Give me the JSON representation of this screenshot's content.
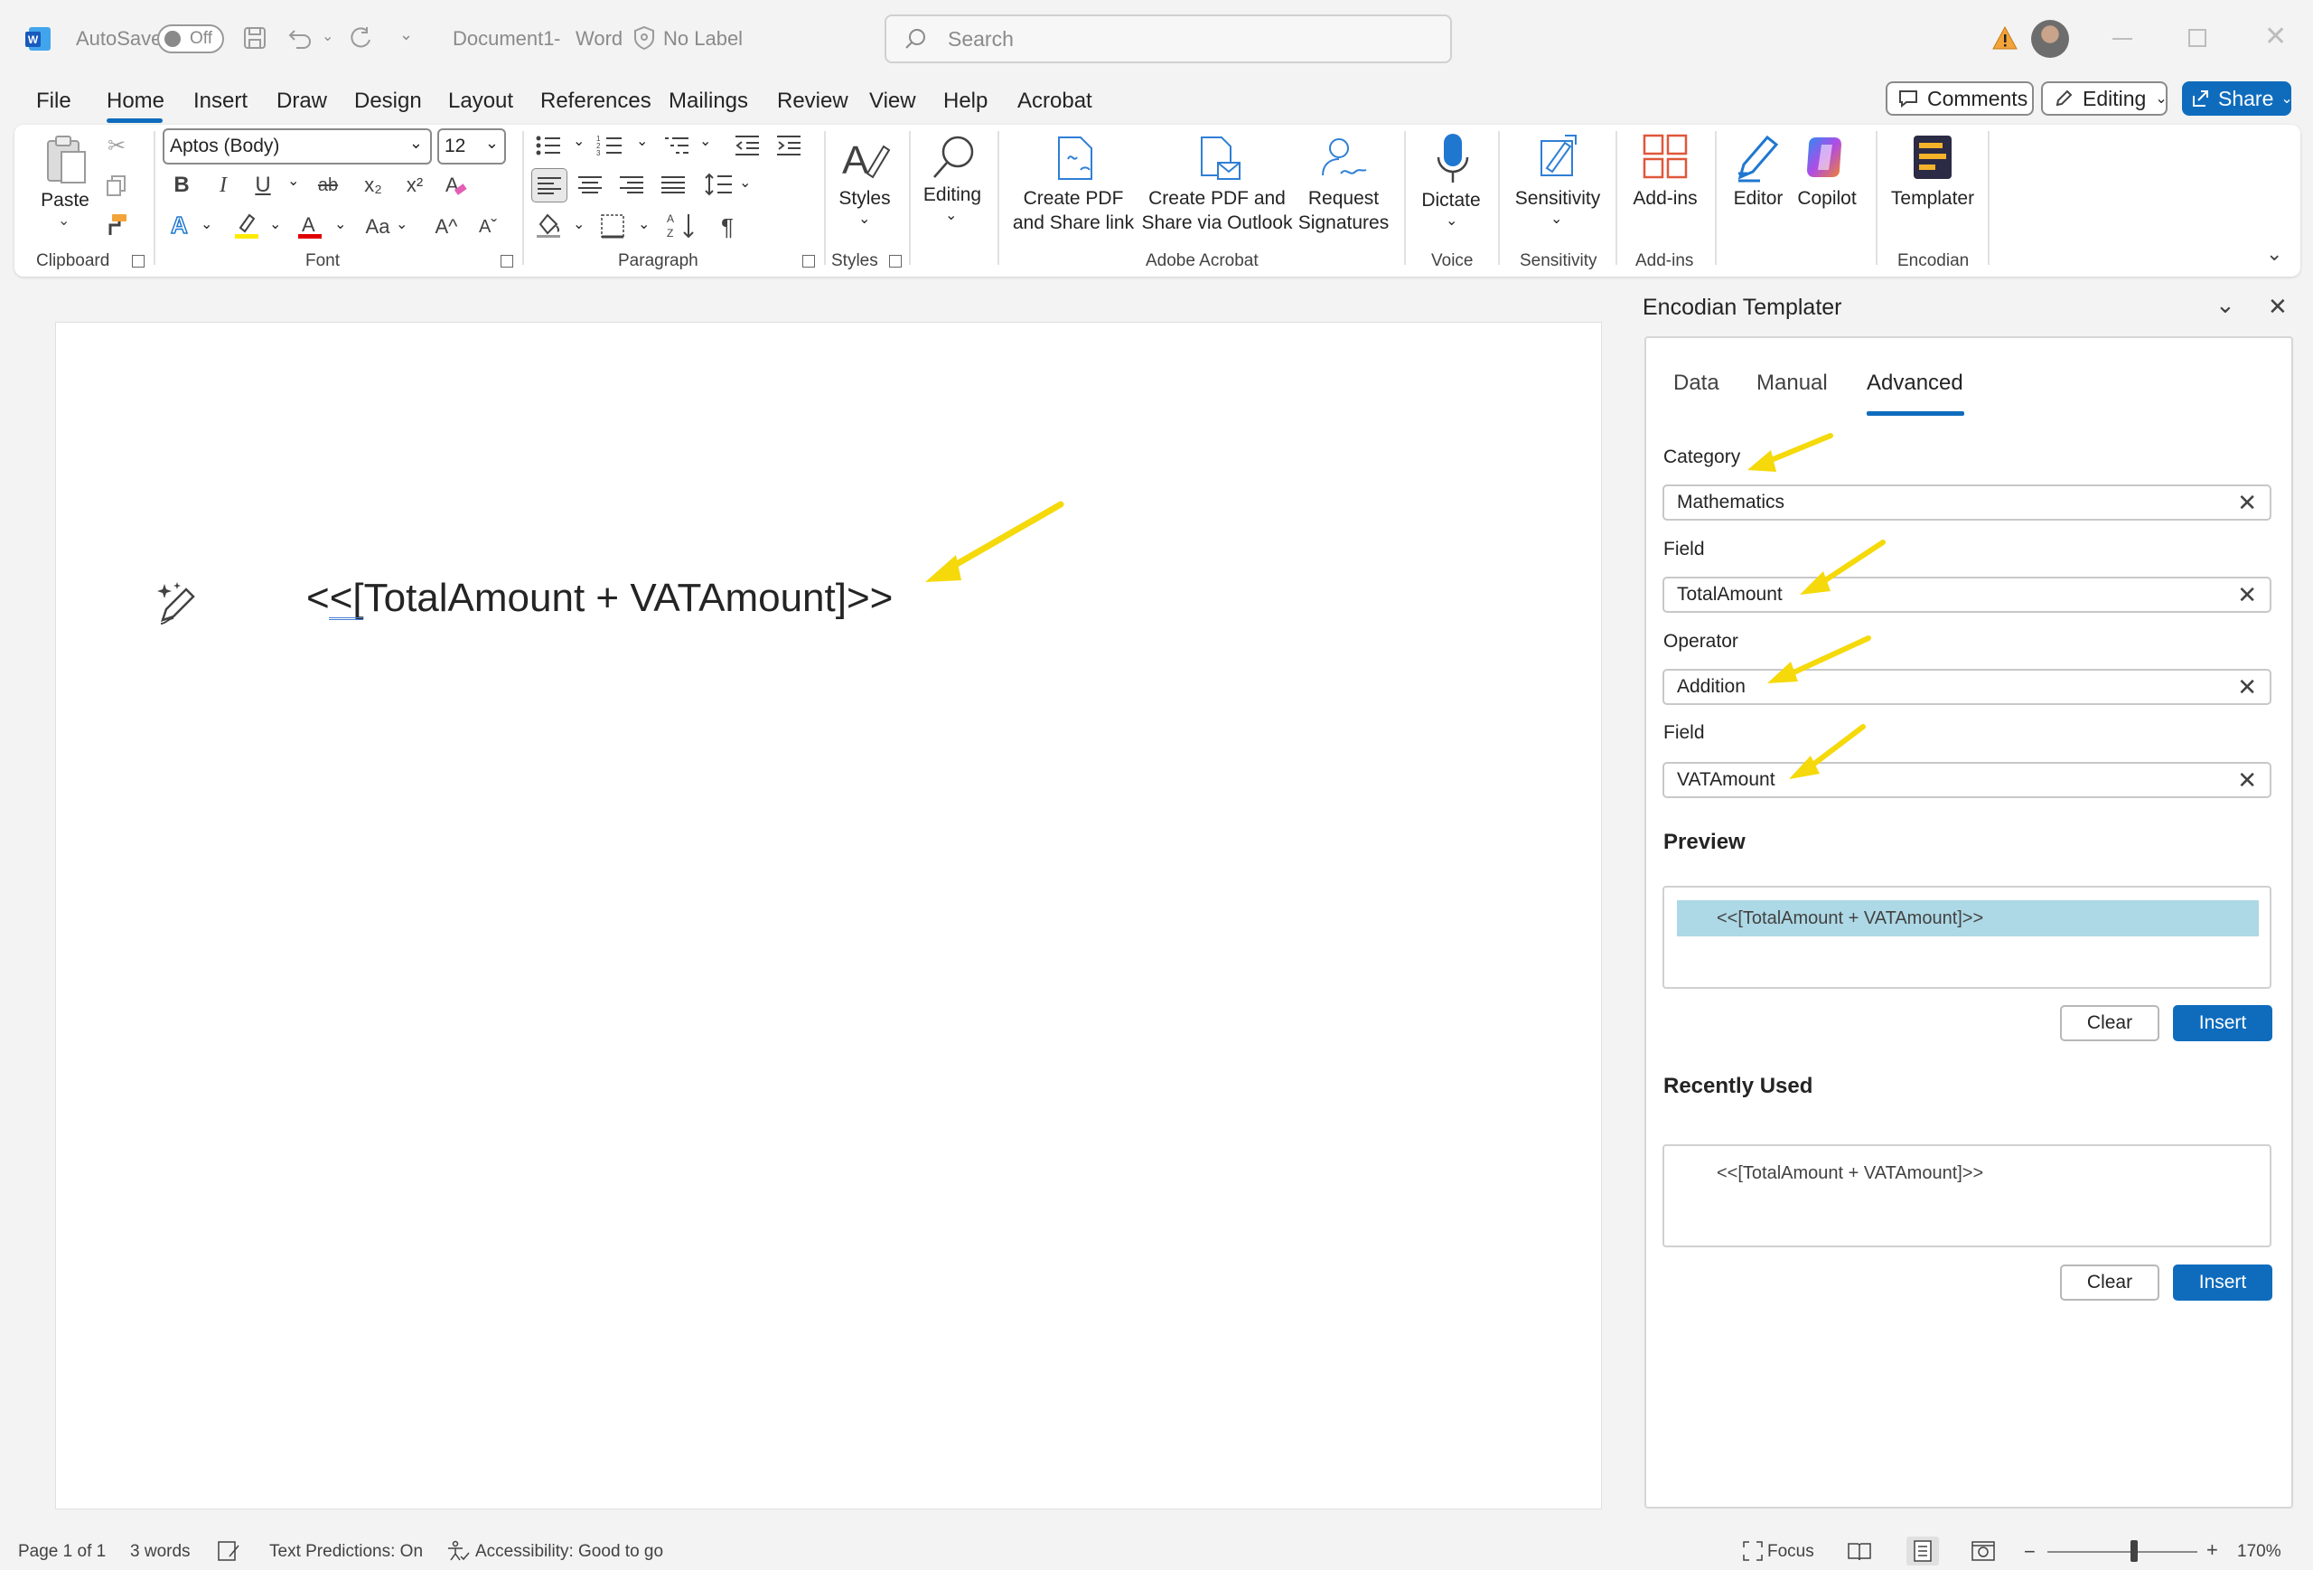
{
  "titlebar": {
    "autosave_label": "AutoSave",
    "autosave_state": "Off",
    "doc_title": "Document1",
    "app_name": "Word",
    "separator": "-",
    "label_status": "No Label",
    "search_placeholder": "Search"
  },
  "menu": {
    "tabs": [
      "File",
      "Home",
      "Insert",
      "Draw",
      "Design",
      "Layout",
      "References",
      "Mailings",
      "Review",
      "View",
      "Help",
      "Acrobat"
    ],
    "active_tab": "Home",
    "comments_label": "Comments",
    "editing_label": "Editing",
    "share_label": "Share"
  },
  "ribbon": {
    "clipboard": {
      "paste_label": "Paste",
      "group_label": "Clipboard"
    },
    "font": {
      "font_name": "Aptos (Body)",
      "font_size": "12",
      "group_label": "Font",
      "bold": "B",
      "italic": "I",
      "underline": "U",
      "strike": "ab",
      "subscript": "x₂",
      "superscript": "x²",
      "grow": "A^",
      "shrink": "Aˇ",
      "case": "Aa"
    },
    "paragraph": {
      "group_label": "Paragraph",
      "pilcrow": "¶"
    },
    "styles": {
      "label": "Styles",
      "group_label": "Styles"
    },
    "editing": {
      "label": "Editing"
    },
    "acrobat": {
      "create_pdf_share_line1": "Create PDF",
      "create_pdf_share_line2": "and Share link",
      "create_pdf_outlook_line1": "Create PDF and",
      "create_pdf_outlook_line2": "Share via Outlook",
      "request_sig_line1": "Request",
      "request_sig_line2": "Signatures",
      "group_label": "Adobe Acrobat"
    },
    "voice": {
      "label": "Dictate",
      "group_label": "Voice"
    },
    "sensitivity": {
      "label": "Sensitivity",
      "group_label": "Sensitivity"
    },
    "addins": {
      "label": "Add-ins",
      "group_label": "Add-ins"
    },
    "editor": {
      "label": "Editor"
    },
    "copilot": {
      "label": "Copilot"
    },
    "encodian": {
      "label": "Templater",
      "group_label": "Encodian"
    }
  },
  "document": {
    "text": "<<[TotalAmount + VATAmount]>>"
  },
  "pane": {
    "title": "Encodian Templater",
    "tabs": [
      "Data",
      "Manual",
      "Advanced"
    ],
    "active_tab": "Advanced",
    "category_label": "Category",
    "category_value": "Mathematics",
    "field1_label": "Field",
    "field1_value": "TotalAmount",
    "operator_label": "Operator",
    "operator_value": "Addition",
    "field2_label": "Field",
    "field2_value": "VATAmount",
    "preview_heading": "Preview",
    "preview_value": "<<[TotalAmount + VATAmount]>>",
    "recent_heading": "Recently Used",
    "recent_value": "<<[TotalAmount + VATAmount]>>",
    "clear_label": "Clear",
    "insert_label": "Insert"
  },
  "status": {
    "page": "Page 1 of 1",
    "words": "3 words",
    "predictions": "Text Predictions: On",
    "accessibility": "Accessibility: Good to go",
    "focus": "Focus",
    "zoom": "170%"
  },
  "colors": {
    "accent": "#0f6cbd",
    "arrow": "#f5d90a",
    "preview_bg": "#add8e6"
  }
}
